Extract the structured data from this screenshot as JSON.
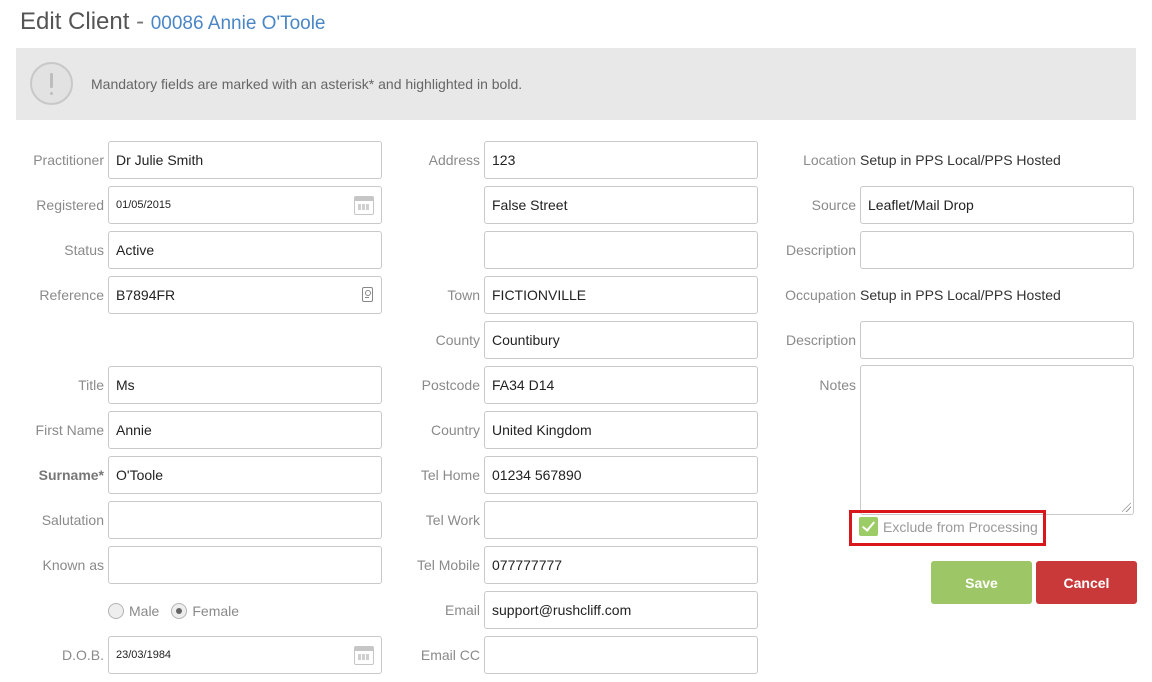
{
  "header": {
    "title": "Edit Client",
    "separator": "-",
    "client": "00086 Annie O'Toole"
  },
  "notice": {
    "icon": "exclamation-icon",
    "text": "Mandatory fields are marked with an asterisk* and highlighted in bold."
  },
  "col1": {
    "practitioner": {
      "label": "Practitioner",
      "value": "Dr Julie Smith"
    },
    "registered": {
      "label": "Registered",
      "value": "01/05/2015"
    },
    "status": {
      "label": "Status",
      "value": "Active"
    },
    "reference": {
      "label": "Reference",
      "value": "B7894FR"
    },
    "title": {
      "label": "Title",
      "value": "Ms"
    },
    "first_name": {
      "label": "First Name",
      "value": "Annie"
    },
    "surname": {
      "label": "Surname*",
      "value": "O'Toole"
    },
    "salutation": {
      "label": "Salutation",
      "value": ""
    },
    "known_as": {
      "label": "Known as",
      "value": ""
    },
    "gender": {
      "male": "Male",
      "female": "Female",
      "selected": "Female"
    },
    "dob": {
      "label": "D.O.B.",
      "value": "23/03/1984"
    }
  },
  "col2": {
    "address": {
      "label": "Address",
      "line1": "123",
      "line2": "False Street",
      "line3": ""
    },
    "town": {
      "label": "Town",
      "value": "FICTIONVILLE"
    },
    "county": {
      "label": "County",
      "value": "Countibury"
    },
    "postcode": {
      "label": "Postcode",
      "value": "FA34 D14"
    },
    "country": {
      "label": "Country",
      "value": "United Kingdom"
    },
    "tel_home": {
      "label": "Tel Home",
      "value": "01234 567890"
    },
    "tel_work": {
      "label": "Tel Work",
      "value": ""
    },
    "tel_mobile": {
      "label": "Tel Mobile",
      "value": "077777777"
    },
    "email": {
      "label": "Email",
      "value": "support@rushcliff.com"
    },
    "email_cc": {
      "label": "Email CC",
      "value": ""
    }
  },
  "col3": {
    "location": {
      "label": "Location",
      "value": "Setup in PPS Local/PPS Hosted"
    },
    "source": {
      "label": "Source",
      "value": "Leaflet/Mail Drop"
    },
    "source_description": {
      "label": "Description",
      "value": ""
    },
    "occupation": {
      "label": "Occupation",
      "value": "Setup in PPS Local/PPS Hosted"
    },
    "occupation_description": {
      "label": "Description",
      "value": ""
    },
    "notes": {
      "label": "Notes",
      "value": ""
    },
    "exclude": {
      "label": "Exclude from Processing",
      "checked": true
    }
  },
  "actions": {
    "save": "Save",
    "cancel": "Cancel"
  },
  "colors": {
    "accent_blue": "#4a86c5",
    "save_green": "#9dc666",
    "cancel_red": "#c9393a",
    "highlight_red": "#d9161c"
  }
}
